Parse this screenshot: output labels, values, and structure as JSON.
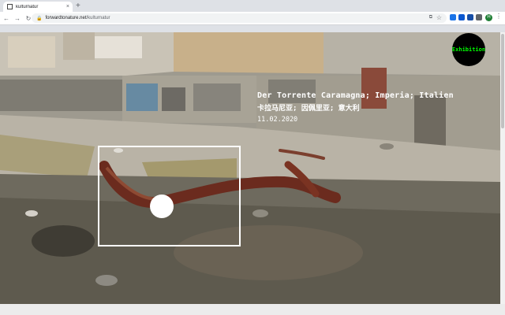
{
  "browser": {
    "tab_title": "kulturnatur",
    "tab_close": "×",
    "new_tab": "+",
    "url_host": "forwardtonature.net",
    "url_path": "/kulturnatur",
    "avatar_letter": "H",
    "profile_color": "#1e7e34"
  },
  "page": {
    "title_line1": "Der Torrente Caramagna; Imperia; Italien",
    "title_line2": "卡拉马尼亚; 因佩里亚; 意大利",
    "date": "11.02.2020",
    "exhibition_label": "Exhibition",
    "exhibition_text_color": "#00ff00"
  }
}
